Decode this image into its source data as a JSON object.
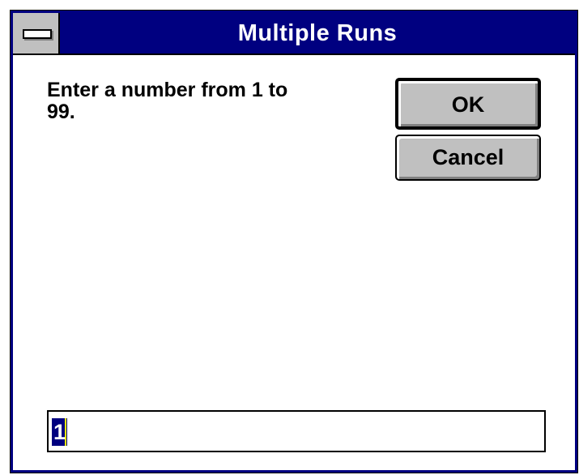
{
  "window": {
    "title": "Multiple Runs",
    "system_menu_icon": "system-menu-dash-icon"
  },
  "dialog": {
    "prompt": "Enter a number from 1 to\n99.",
    "ok_label": "OK",
    "cancel_label": "Cancel",
    "input_value": "1"
  },
  "colors": {
    "titlebar": "#000080",
    "button_face": "#c0c0c0",
    "selection": "#000080"
  }
}
